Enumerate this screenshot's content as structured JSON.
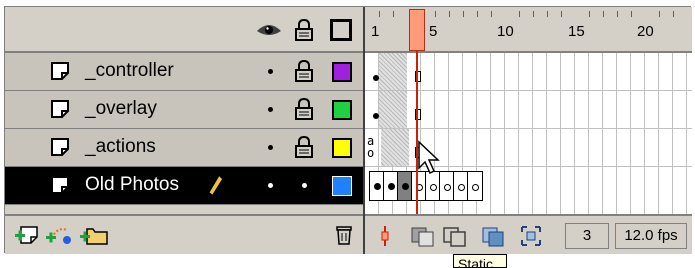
{
  "layers": [
    {
      "name": "_controller",
      "color": "#a020e0",
      "selected": false
    },
    {
      "name": "_overlay",
      "color": "#20d040",
      "selected": false
    },
    {
      "name": "_actions",
      "color": "#ffff00",
      "selected": false
    },
    {
      "name": "Old Photos",
      "color": "#2080ff",
      "selected": true
    }
  ],
  "header_icons": [
    "eye-icon",
    "lock-icon",
    "outline-icon"
  ],
  "footer_icons": [
    "insert-layer-icon",
    "add-motion-guide-icon",
    "insert-layer-folder-icon",
    "trash-icon"
  ],
  "ruler": {
    "labels": [
      "1",
      "5",
      "10",
      "15",
      "20"
    ]
  },
  "actions_frame_label": "a\no",
  "timeline_footer": {
    "current_frame": "3",
    "frame_rate": "12.0 fps",
    "tooltip": "Static"
  }
}
